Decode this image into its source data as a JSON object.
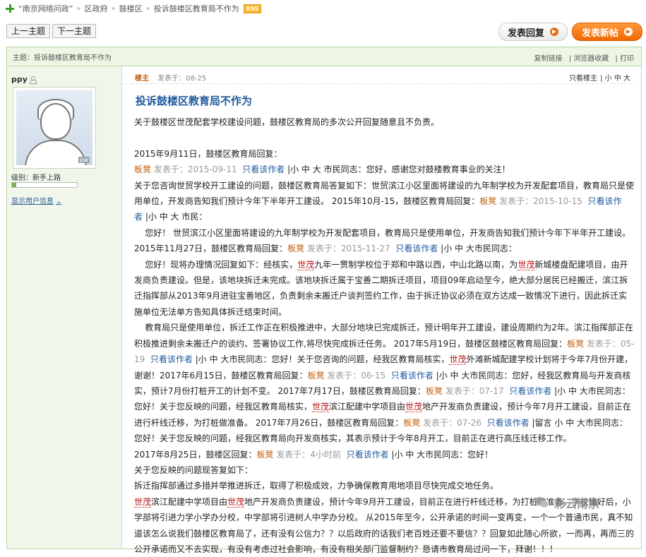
{
  "breadcrumb": {
    "site": "“南京网络问政”",
    "section": "区政府",
    "district": "鼓楼区",
    "thread": "投诉鼓楼区教育局不作为",
    "rss": "RSS"
  },
  "nav": {
    "prev": "上一主题",
    "next": "下一主题",
    "reply": "发表回复",
    "new_post": "发表新帖"
  },
  "topic_bar": {
    "label": "主题：投诉鼓楼区教育局不作为",
    "copy": "复制链接",
    "favorite": "浏览器收藏",
    "print": "打印"
  },
  "user": {
    "name": "ppy",
    "level": "级别：新手上路",
    "level_progress": 0.06,
    "show_info": "显示用户信息"
  },
  "post": {
    "floor": "楼主",
    "time": "发表于：08-25",
    "author_only": "只看楼主",
    "size_small": "小",
    "size_mid": "中",
    "size_big": "大",
    "title": "投诉鼓楼区教育局不作为",
    "intro": "关于鼓楼区世茂配套学校建设问题，鼓楼区教育局的多次公开回复随意且不负责。",
    "p1": "2015年9月11日，鼓楼区教育局回复：",
    "bd": "板凳",
    "t0911": "发表于：2015-09-11",
    "only": "只看该作者",
    "sizes": "|小 中 大",
    "greet1": "市民同志：您好，感谢您对鼓楼教育事业的关注！",
    "p3a": "关于您咨询世贸学校开工建设的问题，鼓楼区教育局答复如下：世贸滨江小区里面将建设的九年制学校为开发配套项目，教育局只是使用单位，开发商告知我们预计今年下半年开工建设。 2015年10月-15，鼓楼区教育局回复：",
    "t1015": "发表于：2015-10-15",
    "only2a": "只看该作",
    "only2b": "者",
    "sizes2": "|小 中 大",
    "citizen": "市民：",
    "p4": "您好！ 世贸滨江小区里面将建设的九年制学校为开发配套项目，教育局只是使用单位，开发商告知我们预计今年下半年开工建设。2015年11月27日，鼓楼区教育局回复：",
    "t1127": "发表于：2015-11-27",
    "sizes3": "|小 中 大市民同志：",
    "p5a": "您好！现将办理情况回复如下：经核实，",
    "sm": "世茂",
    "p5b": "九年一贯制学校位于郑和中路以西，中山北路以南，为",
    "p5c": "新城楼盘配建项目，由开发商负责建设。但是，该地块拆迁未完成。该地块拆迁属于宝善二期拆迁项目，项目09年启动至今，绝大部分居民已经搬迁，滨江拆迁指挥部从2013年9月进驻宝善地区，负责剩余未搬迁户谈判签约工作，由于拆迁协议必须在双方达成一致情况下进行，因此拆迁实施单位无法单方告知具体拆迁结束时间。",
    "p6a": "教育局只是使用单位，拆迁工作正在积极推进中，大部分地块已完成拆迁，预计明年开工建设，建设周期约为2年。滨江指挥部正在积极推进剩余未搬迁户的谈约、签署协议工作,将尽快完成拆迁任务。 2017年5月19日，鼓楼区鼓楼区教育局回复：",
    "t0519": "发表于：05-19",
    "sizes4": "|小 中 大市民同志：",
    "p6b": "您好！关于您咨询的问题，经我区教育局核实，",
    "p6c": "外滩新城配建学校计划将于今年7月份开建，谢谢！2017年6月15日，鼓楼区教育局回复：",
    "t0615": "发表于：06-15",
    "sizes5": "|小 中 大市民同志：",
    "p6d": "您好，经我区教育局与开发商核实，预计7月份打桩开工的计划不变。 2017年7月17日，鼓楼区教育局回复：",
    "t0717": "发表于：07-17",
    "sizes6": "|小 中 大市",
    "p6e": "民同志：您好！关于您反映的问题，经我区教育局核实，",
    "p6f": "滨江配建中学项目由",
    "p6g": "地产开发商负责建设，预计今年7月开工建设，目前正在进行杆线迁移，为打桩做准备。 2017年7月26日，鼓楼区教育局回复：",
    "t0726": "发表于：07-26",
    "sizes7": "|留言 小 中 大",
    "p6h": "市民同志：您好！关于您反映的问题，经我区教育局向开发商核实，其表示预计于今年8月开工，目前正在进行高压线迁移工作。",
    "p7": "2017年8月25日，鼓楼区回复：",
    "t0825": "发表于：4小时前",
    "sizes8": "|小 中 大市民同志：您好！",
    "p8": "关于您反映的问题现答复如下：",
    "p9": "拆迁指挥部通过多措并举推进拆迁，取得了积极成效，力争确保教育用地项目尽快完成交地任务。",
    "p10a": "滨江配建中学项目由",
    "p10b": "地产开发商负责建设，预计今年9月开工建设，目前正在进行杆线迁移，为打桩做准备。学校建好后，小学部将引进力学小学办分校，中学部将引进树人中学办分校。 从2015年至今，公开承诺的时间一变再变，一个一个普通市民，真不知道该怎么说我们鼓楼区教育局了，还有没有公信力？？以后政府的话我们老百姓还要不要信？？回复如此随心所欲，一而再，再而三的公开承诺而又不去实现，有没有考虑过社会影响，有没有相关部门监督制约？恳请市教育局过问一下，拜谢！！！"
  },
  "watermark": "彩云南京"
}
